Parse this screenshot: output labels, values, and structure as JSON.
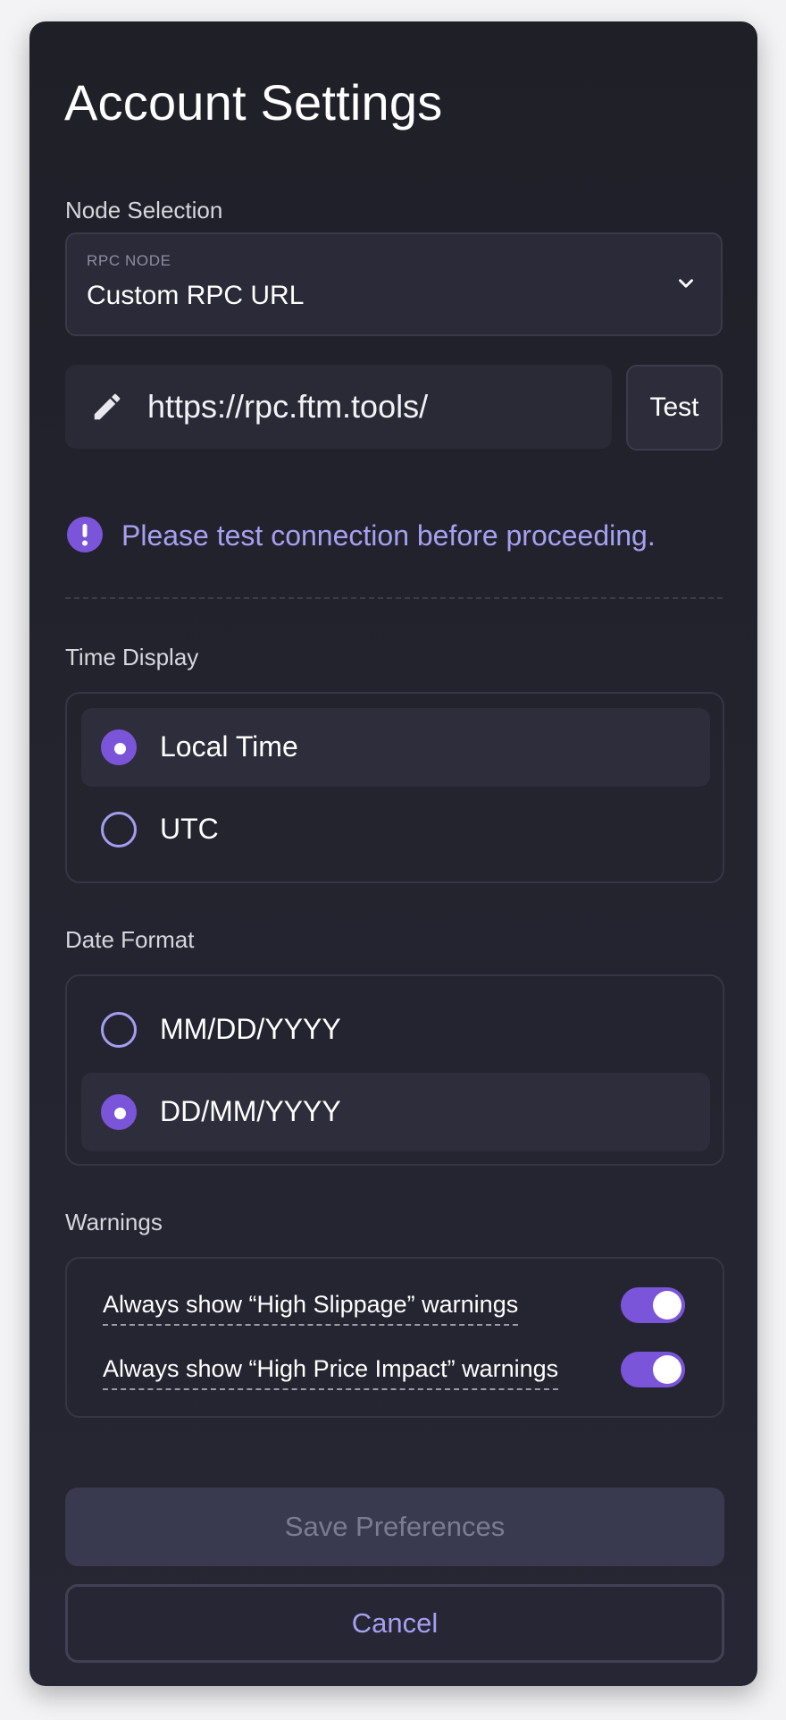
{
  "page": {
    "title": "Account Settings"
  },
  "node_selection": {
    "section_label": "Node Selection",
    "select_label": "RPC NODE",
    "select_value": "Custom RPC URL",
    "url_value": "https://rpc.ftm.tools/",
    "test_label": "Test",
    "warning_text": "Please test connection before proceeding.",
    "warning_icon": "exclamation-circle-icon"
  },
  "time_display": {
    "section_label": "Time Display",
    "options": [
      {
        "label": "Local Time",
        "selected": true
      },
      {
        "label": "UTC",
        "selected": false
      }
    ]
  },
  "date_format": {
    "section_label": "Date Format",
    "options": [
      {
        "label": "MM/DD/YYYY",
        "selected": false
      },
      {
        "label": "DD/MM/YYYY",
        "selected": true
      }
    ]
  },
  "warnings": {
    "section_label": "Warnings",
    "items": [
      {
        "label": "Always show “High Slippage” warnings",
        "enabled": true
      },
      {
        "label": "Always show “High Price Impact” warnings",
        "enabled": true
      }
    ]
  },
  "actions": {
    "save_label": "Save Preferences",
    "cancel_label": "Cancel"
  },
  "colors": {
    "accent": "#7b55d9",
    "accent_text": "#a6a0f0",
    "background": "#23232e"
  }
}
